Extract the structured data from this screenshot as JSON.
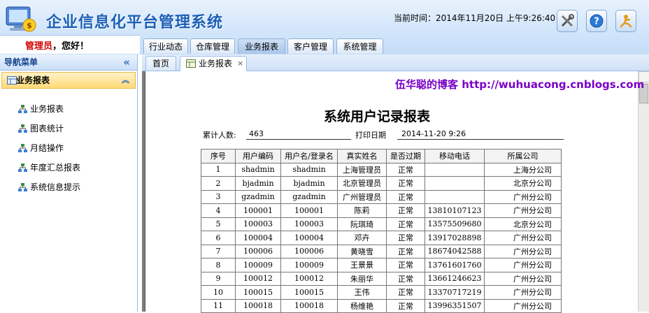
{
  "app": {
    "title": "企业信息化平台管理系统",
    "current_time": "当前时间：2014年11月20日 上午9:26:40"
  },
  "header": {
    "buttons": [
      {
        "icon": "tools-icon"
      },
      {
        "icon": "help-icon"
      },
      {
        "icon": "exit-icon"
      }
    ]
  },
  "user": {
    "role": "管理员",
    "greeting": "，您好！"
  },
  "main_tabs": [
    "行业动态",
    "仓库管理",
    "业务报表",
    "客户管理",
    "系统管理"
  ],
  "nav": {
    "title": "导航菜单",
    "collapse_glyph": "«",
    "section": "业务报表",
    "section_glyph": "︽",
    "items": [
      "业务报表",
      "图表统计",
      "月结操作",
      "年度汇总报表",
      "系统信息提示"
    ]
  },
  "content_tabs": {
    "home": "首页",
    "active": "业务报表",
    "close_glyph": "×"
  },
  "report": {
    "blog_text": "伍华聪的博客 http://wuhuacong.cnblogs.com",
    "title": "系统用户记录报表",
    "count_label": "累计人数:",
    "count_value": "463",
    "print_label": "打印日期",
    "print_value": "2014-11-20 9:26",
    "columns": [
      "序号",
      "用户编码",
      "用户名/登录名",
      "真实姓名",
      "是否过期",
      "移动电话",
      "所属公司"
    ],
    "rows": [
      [
        "1",
        "shadmin",
        "shadmin",
        "上海管理员",
        "正常",
        "",
        "上海分公司"
      ],
      [
        "2",
        "bjadmin",
        "bjadmin",
        "北京管理员",
        "正常",
        "",
        "北京分公司"
      ],
      [
        "3",
        "gzadmin",
        "gzadmin",
        "广州管理员",
        "正常",
        "",
        "广州分公司"
      ],
      [
        "4",
        "100001",
        "100001",
        "陈莉",
        "正常",
        "13810107123",
        "广州分公司"
      ],
      [
        "5",
        "100003",
        "100003",
        "阮琪琦",
        "正常",
        "13575509680",
        "北京分公司"
      ],
      [
        "6",
        "100004",
        "100004",
        "邓卉",
        "正常",
        "13917028898",
        "广州分公司"
      ],
      [
        "7",
        "100006",
        "100006",
        "黄晓雪",
        "正常",
        "18674042588",
        "广州分公司"
      ],
      [
        "8",
        "100009",
        "100009",
        "王景景",
        "正常",
        "13761601760",
        "广州分公司"
      ],
      [
        "9",
        "100012",
        "100012",
        "朱丽华",
        "正常",
        "13661246623",
        "广州分公司"
      ],
      [
        "10",
        "100015",
        "100015",
        "王伟",
        "正常",
        "13370717219",
        "广州分公司"
      ],
      [
        "11",
        "100018",
        "100018",
        "杨维艳",
        "正常",
        "13996351507",
        "广州分公司"
      ]
    ]
  },
  "colors": {
    "title_blue": "#1d5fb5",
    "role_red": "#d40000",
    "blog_purple": "#7a00c8"
  }
}
